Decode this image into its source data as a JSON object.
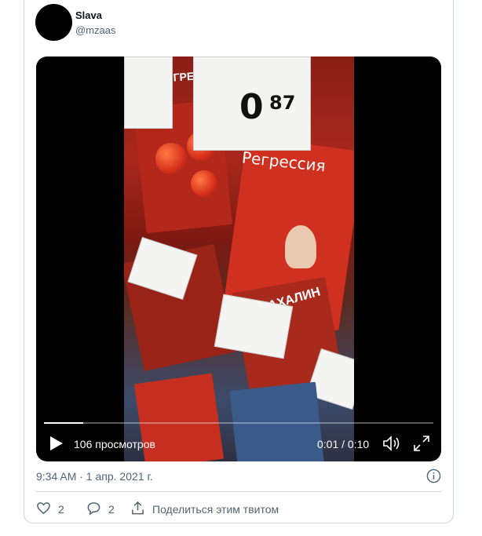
{
  "tweet": {
    "author_name": "Slava",
    "author_handle": "@mzaas",
    "timestamp": "9:34 AM · 1 апр. 2021 г."
  },
  "video": {
    "views_label": "106 просмотров",
    "time_label": "0:01 / 0:10",
    "progress": 0.1,
    "frame_text": {
      "price_main": "0",
      "price_cents": "87",
      "brand": "Регрессия",
      "pack_label": "ТИГРЕН",
      "pack_label_2": "САХАЛИН"
    }
  },
  "actions": {
    "likes": "2",
    "replies": "2",
    "share_label": "Поделиться этим твитом"
  },
  "icons": {
    "like": "heart-icon",
    "reply": "speech-bubble-icon",
    "share": "share-icon",
    "info": "info-icon",
    "play": "play-icon",
    "volume": "volume-icon",
    "fullscreen": "fullscreen-icon"
  },
  "colors": {
    "secondary_text": "#536471",
    "border": "#cfd9de",
    "video_bg": "#000000"
  }
}
